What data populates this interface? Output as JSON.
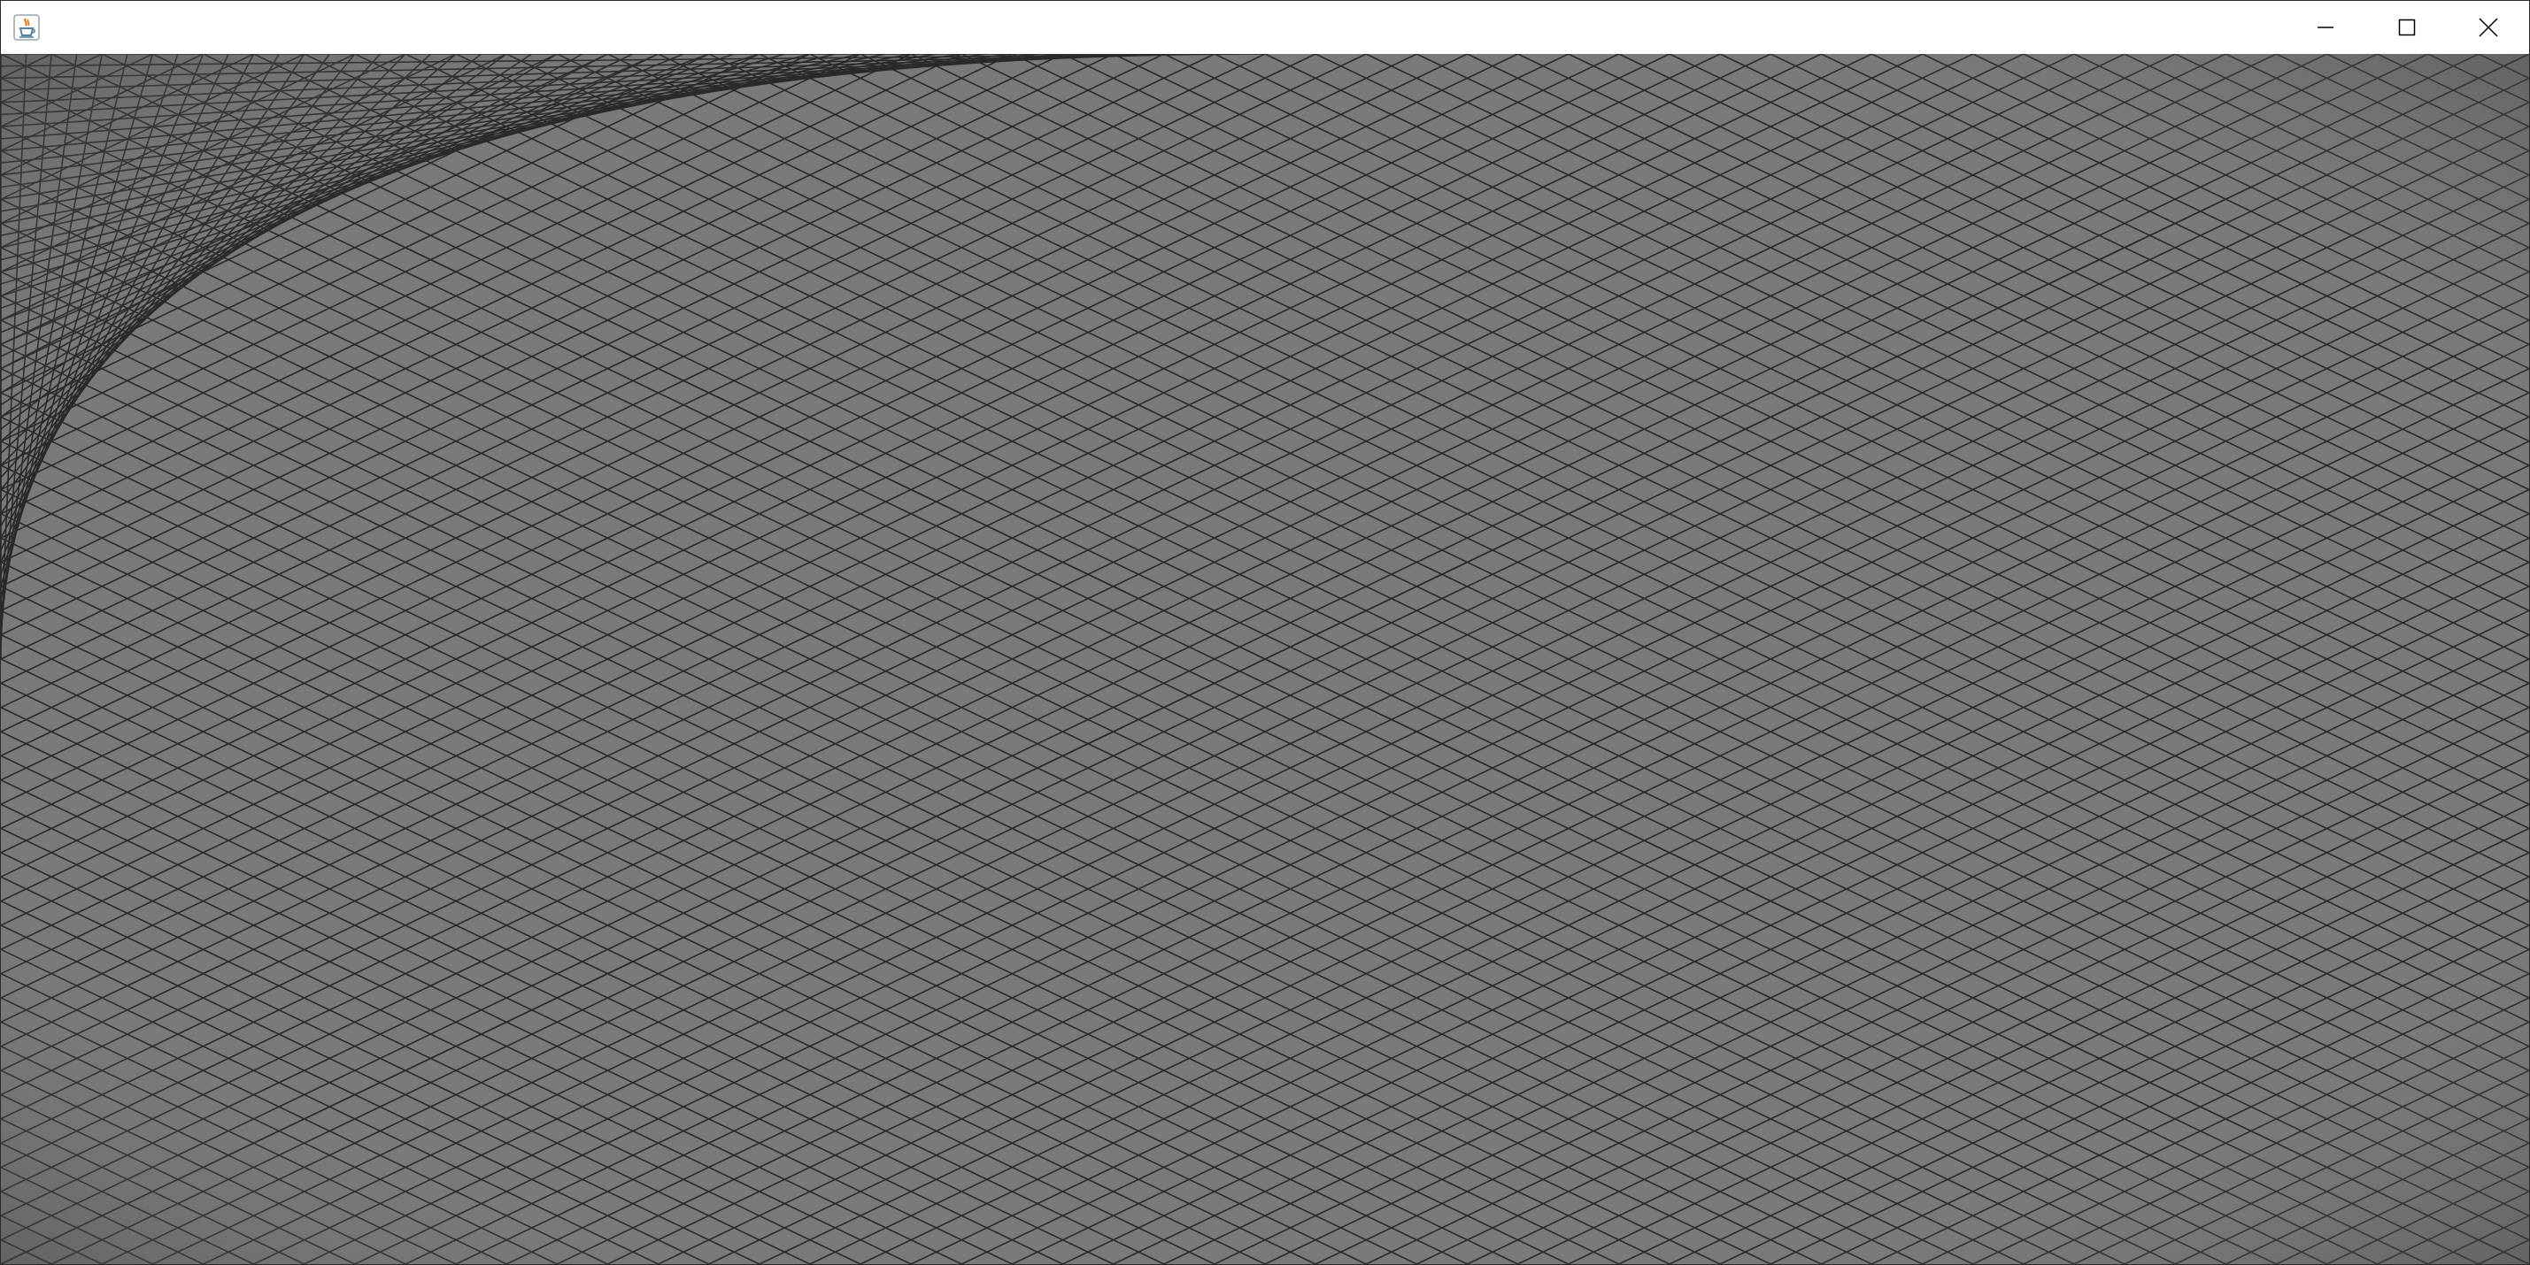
{
  "window": {
    "title": "",
    "app_icon": "java-coffee-cup-icon"
  },
  "title_controls": {
    "minimize_icon": "minimize-icon",
    "maximize_icon": "maximize-icon",
    "close_icon": "close-icon"
  },
  "canvas": {
    "description_kind": "string-art-mesh",
    "background_color": "#7a7a7a",
    "line_color": "#2a2a2a",
    "edge_shade_color": "#3a3a3a",
    "line_count_per_side": 50
  }
}
